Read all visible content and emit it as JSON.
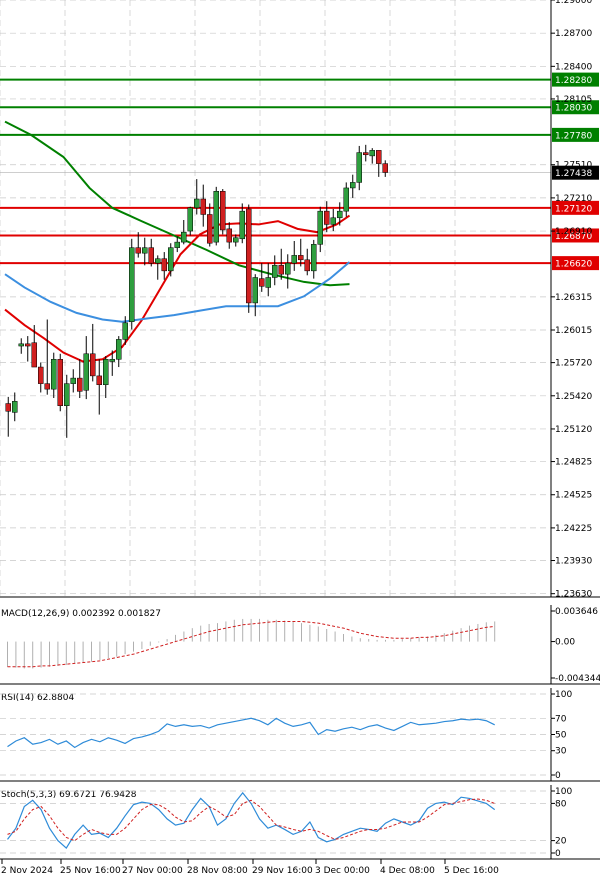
{
  "chart_data": {
    "type": "candlestick",
    "x_tick_labels": [
      "2 Nov 2024",
      "25 Nov 16:00",
      "27 Nov 00:00",
      "28 Nov 08:00",
      "29 Nov 16:00",
      "3 Dec 00:00",
      "4 Dec 08:00",
      "5 Dec 16:00"
    ],
    "price_axis": {
      "range": [
        1.236,
        1.29
      ],
      "ticks": [
        "1.29000",
        "1.28700",
        "1.28400",
        "1.28105",
        "1.27510",
        "1.27210",
        "1.26910",
        "1.26315",
        "1.26015",
        "1.25720",
        "1.25420",
        "1.25120",
        "1.24825",
        "1.24525",
        "1.24225",
        "1.23930",
        "1.23630"
      ],
      "current_price": "1.27438",
      "grid": true
    },
    "horizontal_levels": [
      {
        "label": "1.28280",
        "value": 1.2828,
        "color": "#008000"
      },
      {
        "label": "1.28030",
        "value": 1.2803,
        "color": "#008000"
      },
      {
        "label": "1.27780",
        "value": 1.2778,
        "color": "#008000"
      },
      {
        "label": "1.27120",
        "value": 1.2712,
        "color": "#e00000"
      },
      {
        "label": "1.26870",
        "value": 1.2687,
        "color": "#e00000"
      },
      {
        "label": "1.26620",
        "value": 1.2662,
        "color": "#e00000"
      }
    ],
    "candles": [
      {
        "o": 1.2535,
        "h": 1.2541,
        "l": 1.2505,
        "c": 1.2528
      },
      {
        "o": 1.2527,
        "h": 1.2545,
        "l": 1.2519,
        "c": 1.2537
      },
      {
        "o": 1.2587,
        "h": 1.2594,
        "l": 1.258,
        "c": 1.2589
      },
      {
        "o": 1.2589,
        "h": 1.2596,
        "l": 1.2573,
        "c": 1.2587
      },
      {
        "o": 1.259,
        "h": 1.2606,
        "l": 1.257,
        "c": 1.2568
      },
      {
        "o": 1.2568,
        "h": 1.2572,
        "l": 1.2545,
        "c": 1.2553
      },
      {
        "o": 1.2553,
        "h": 1.2611,
        "l": 1.2543,
        "c": 1.2548
      },
      {
        "o": 1.2548,
        "h": 1.2581,
        "l": 1.254,
        "c": 1.2575
      },
      {
        "o": 1.2575,
        "h": 1.258,
        "l": 1.2528,
        "c": 1.2533
      },
      {
        "o": 1.2533,
        "h": 1.2561,
        "l": 1.2504,
        "c": 1.2553
      },
      {
        "o": 1.2553,
        "h": 1.2566,
        "l": 1.2545,
        "c": 1.2558
      },
      {
        "o": 1.2558,
        "h": 1.2575,
        "l": 1.254,
        "c": 1.2546
      },
      {
        "o": 1.2547,
        "h": 1.2596,
        "l": 1.2539,
        "c": 1.258
      },
      {
        "o": 1.258,
        "h": 1.2607,
        "l": 1.2555,
        "c": 1.256
      },
      {
        "o": 1.256,
        "h": 1.2575,
        "l": 1.2525,
        "c": 1.2552
      },
      {
        "o": 1.2552,
        "h": 1.2578,
        "l": 1.254,
        "c": 1.2575
      },
      {
        "o": 1.2573,
        "h": 1.2583,
        "l": 1.256,
        "c": 1.2575
      },
      {
        "o": 1.2575,
        "h": 1.2596,
        "l": 1.2568,
        "c": 1.2593
      },
      {
        "o": 1.2593,
        "h": 1.2614,
        "l": 1.2588,
        "c": 1.2608
      },
      {
        "o": 1.2609,
        "h": 1.2684,
        "l": 1.2602,
        "c": 1.2676
      },
      {
        "o": 1.2676,
        "h": 1.269,
        "l": 1.2667,
        "c": 1.2671
      },
      {
        "o": 1.2671,
        "h": 1.2685,
        "l": 1.266,
        "c": 1.2676
      },
      {
        "o": 1.2676,
        "h": 1.2684,
        "l": 1.2659,
        "c": 1.2662
      },
      {
        "o": 1.2662,
        "h": 1.2669,
        "l": 1.2647,
        "c": 1.2666
      },
      {
        "o": 1.2666,
        "h": 1.2672,
        "l": 1.2647,
        "c": 1.2655
      },
      {
        "o": 1.2655,
        "h": 1.268,
        "l": 1.265,
        "c": 1.2676
      },
      {
        "o": 1.2676,
        "h": 1.2686,
        "l": 1.2672,
        "c": 1.2681
      },
      {
        "o": 1.2681,
        "h": 1.2701,
        "l": 1.2679,
        "c": 1.269
      },
      {
        "o": 1.2691,
        "h": 1.2713,
        "l": 1.2687,
        "c": 1.2712
      },
      {
        "o": 1.2712,
        "h": 1.2738,
        "l": 1.2706,
        "c": 1.272
      },
      {
        "o": 1.272,
        "h": 1.2733,
        "l": 1.2695,
        "c": 1.2706
      },
      {
        "o": 1.2706,
        "h": 1.2716,
        "l": 1.2677,
        "c": 1.268
      },
      {
        "o": 1.2681,
        "h": 1.2731,
        "l": 1.2678,
        "c": 1.2727
      },
      {
        "o": 1.2727,
        "h": 1.2729,
        "l": 1.2688,
        "c": 1.2692
      },
      {
        "o": 1.2693,
        "h": 1.2699,
        "l": 1.2675,
        "c": 1.2681
      },
      {
        "o": 1.2681,
        "h": 1.2688,
        "l": 1.2677,
        "c": 1.2685
      },
      {
        "o": 1.2684,
        "h": 1.2716,
        "l": 1.268,
        "c": 1.2709
      },
      {
        "o": 1.2711,
        "h": 1.2715,
        "l": 1.2617,
        "c": 1.2626
      },
      {
        "o": 1.2626,
        "h": 1.2652,
        "l": 1.2614,
        "c": 1.2649
      },
      {
        "o": 1.2648,
        "h": 1.2662,
        "l": 1.2636,
        "c": 1.2641
      },
      {
        "o": 1.264,
        "h": 1.2662,
        "l": 1.2632,
        "c": 1.2649
      },
      {
        "o": 1.2649,
        "h": 1.2669,
        "l": 1.2642,
        "c": 1.266
      },
      {
        "o": 1.266,
        "h": 1.2675,
        "l": 1.2647,
        "c": 1.2652
      },
      {
        "o": 1.2652,
        "h": 1.267,
        "l": 1.2639,
        "c": 1.2662
      },
      {
        "o": 1.2662,
        "h": 1.2682,
        "l": 1.2655,
        "c": 1.2669
      },
      {
        "o": 1.2669,
        "h": 1.2684,
        "l": 1.2659,
        "c": 1.2665
      },
      {
        "o": 1.2665,
        "h": 1.2675,
        "l": 1.2651,
        "c": 1.2655
      },
      {
        "o": 1.2655,
        "h": 1.2683,
        "l": 1.2648,
        "c": 1.2679
      },
      {
        "o": 1.2679,
        "h": 1.2713,
        "l": 1.2672,
        "c": 1.2709
      },
      {
        "o": 1.2709,
        "h": 1.2718,
        "l": 1.269,
        "c": 1.2697
      },
      {
        "o": 1.2697,
        "h": 1.2711,
        "l": 1.2691,
        "c": 1.2703
      },
      {
        "o": 1.2703,
        "h": 1.2717,
        "l": 1.2696,
        "c": 1.2709
      },
      {
        "o": 1.2709,
        "h": 1.2735,
        "l": 1.2704,
        "c": 1.273
      },
      {
        "o": 1.273,
        "h": 1.2742,
        "l": 1.2721,
        "c": 1.2735
      },
      {
        "o": 1.2735,
        "h": 1.2768,
        "l": 1.2728,
        "c": 1.2762
      },
      {
        "o": 1.2762,
        "h": 1.2769,
        "l": 1.2754,
        "c": 1.276
      },
      {
        "o": 1.2759,
        "h": 1.2766,
        "l": 1.2752,
        "c": 1.2764
      },
      {
        "o": 1.2764,
        "h": 1.2764,
        "l": 1.274,
        "c": 1.2752
      },
      {
        "o": 1.2752,
        "h": 1.2755,
        "l": 1.274,
        "c": 1.2744
      }
    ],
    "moving_averages": [
      {
        "color": "#008000",
        "points": [
          [
            0,
            1.279
          ],
          [
            8,
            1.2778
          ],
          [
            18,
            1.2758
          ],
          [
            26,
            1.273
          ],
          [
            33,
            1.2712
          ],
          [
            42,
            1.27
          ],
          [
            52,
            1.2687
          ],
          [
            62,
            1.2674
          ],
          [
            72,
            1.266
          ],
          [
            82,
            1.2652
          ],
          [
            92,
            1.2645
          ],
          [
            100,
            1.2642
          ],
          [
            106,
            1.2643
          ]
        ]
      },
      {
        "color": "#e00000",
        "points": [
          [
            0,
            1.262
          ],
          [
            6,
            1.2606
          ],
          [
            12,
            1.2594
          ],
          [
            18,
            1.2581
          ],
          [
            24,
            1.2573
          ],
          [
            30,
            1.2575
          ],
          [
            36,
            1.2586
          ],
          [
            42,
            1.261
          ],
          [
            48,
            1.264
          ],
          [
            54,
            1.267
          ],
          [
            60,
            1.2688
          ],
          [
            66,
            1.2697
          ],
          [
            72,
            1.2698
          ],
          [
            78,
            1.2697
          ],
          [
            84,
            1.27
          ],
          [
            90,
            1.2693
          ],
          [
            96,
            1.269
          ],
          [
            102,
            1.2697
          ],
          [
            106,
            1.2705
          ]
        ]
      },
      {
        "color": "#3c8fe0",
        "points": [
          [
            0,
            1.2652
          ],
          [
            6,
            1.264
          ],
          [
            14,
            1.2627
          ],
          [
            22,
            1.2617
          ],
          [
            30,
            1.2611
          ],
          [
            36,
            1.2609
          ],
          [
            44,
            1.2612
          ],
          [
            52,
            1.2615
          ],
          [
            60,
            1.2619
          ],
          [
            68,
            1.2623
          ],
          [
            76,
            1.2623
          ],
          [
            84,
            1.2623
          ],
          [
            92,
            1.2632
          ],
          [
            100,
            1.2648
          ],
          [
            106,
            1.2663
          ]
        ]
      }
    ],
    "macd": {
      "label": "MACD(12,26,9) 0.002392 0.001827",
      "ticks": [
        "0.003646",
        "0.00",
        "-0.004344"
      ],
      "range": [
        -0.004344,
        0.003646
      ],
      "histogram": [
        -0.003,
        -0.0031,
        -0.0032,
        -0.0032,
        -0.0031,
        -0.003,
        -0.0029,
        -0.0028,
        -0.0026,
        -0.0025,
        -0.0024,
        -0.0022,
        -0.002,
        -0.0018,
        -0.0015,
        -0.0012,
        -0.0009,
        -0.0005,
        -0.0001,
        0.0003,
        0.0008,
        0.0012,
        0.0016,
        0.0019,
        0.0021,
        0.0022,
        0.0024,
        0.0026,
        0.0027,
        0.0027,
        0.0027,
        0.0026,
        0.0026,
        0.0025,
        0.0024,
        0.0022,
        0.002,
        0.0018,
        0.0015,
        0.0012,
        0.0009,
        0.0006,
        0.0004,
        0.0003,
        0.0002,
        0.0002,
        0.0002,
        0.0003,
        0.0004,
        0.0005,
        0.0006,
        0.0008,
        0.001,
        0.0013,
        0.0016,
        0.0019,
        0.0021,
        0.0023,
        0.0024
      ],
      "signal": [
        -0.003,
        -0.003,
        -0.003,
        -0.003,
        -0.0029,
        -0.0029,
        -0.0028,
        -0.0027,
        -0.0026,
        -0.0025,
        -0.0024,
        -0.0023,
        -0.0021,
        -0.0019,
        -0.0017,
        -0.0015,
        -0.0012,
        -0.0009,
        -0.0006,
        -0.0003,
        0.0,
        0.0003,
        0.0006,
        0.0009,
        0.0012,
        0.0014,
        0.0016,
        0.0018,
        0.002,
        0.0021,
        0.0022,
        0.0023,
        0.0024,
        0.0024,
        0.0024,
        0.0024,
        0.0023,
        0.0022,
        0.002,
        0.0018,
        0.0016,
        0.0013,
        0.001,
        0.0008,
        0.0006,
        0.0005,
        0.0004,
        0.0004,
        0.0004,
        0.0005,
        0.0005,
        0.0006,
        0.0007,
        0.0009,
        0.0011,
        0.0013,
        0.0015,
        0.0017,
        0.0018
      ]
    },
    "rsi": {
      "label": "RSI(14) 62.8804",
      "ticks": [
        "100",
        "70",
        "50",
        "30",
        "0"
      ],
      "range": [
        0,
        100
      ],
      "values": [
        35,
        42,
        46,
        38,
        40,
        44,
        38,
        42,
        34,
        40,
        44,
        41,
        46,
        43,
        39,
        45,
        47,
        50,
        54,
        63,
        60,
        62,
        60,
        61,
        58,
        62,
        64,
        66,
        68,
        70,
        67,
        62,
        70,
        64,
        60,
        62,
        65,
        50,
        56,
        54,
        57,
        59,
        56,
        60,
        62,
        58,
        55,
        60,
        65,
        62,
        63,
        64,
        66,
        67,
        69,
        68,
        69,
        67,
        62
      ]
    },
    "stoch": {
      "label": "Stoch(5,3,3) 69.6721 76.9428",
      "ticks": [
        "100",
        "80",
        "20",
        "0"
      ],
      "range": [
        0,
        100
      ],
      "k": [
        22,
        40,
        75,
        85,
        70,
        40,
        20,
        8,
        30,
        45,
        30,
        32,
        25,
        40,
        60,
        78,
        82,
        80,
        70,
        55,
        45,
        48,
        70,
        88,
        75,
        45,
        55,
        80,
        97,
        80,
        55,
        40,
        45,
        38,
        30,
        35,
        50,
        25,
        18,
        22,
        30,
        35,
        40,
        38,
        35,
        48,
        55,
        50,
        45,
        52,
        72,
        80,
        82,
        78,
        90,
        88,
        84,
        80,
        70
      ],
      "d": [
        30,
        35,
        55,
        70,
        75,
        60,
        40,
        25,
        20,
        30,
        38,
        33,
        30,
        30,
        40,
        55,
        70,
        78,
        78,
        70,
        58,
        50,
        52,
        65,
        75,
        68,
        58,
        62,
        80,
        85,
        75,
        60,
        45,
        42,
        38,
        35,
        38,
        35,
        28,
        22,
        25,
        30,
        35,
        38,
        38,
        40,
        45,
        50,
        50,
        50,
        58,
        68,
        78,
        80,
        83,
        86,
        87,
        85,
        80
      ]
    }
  }
}
